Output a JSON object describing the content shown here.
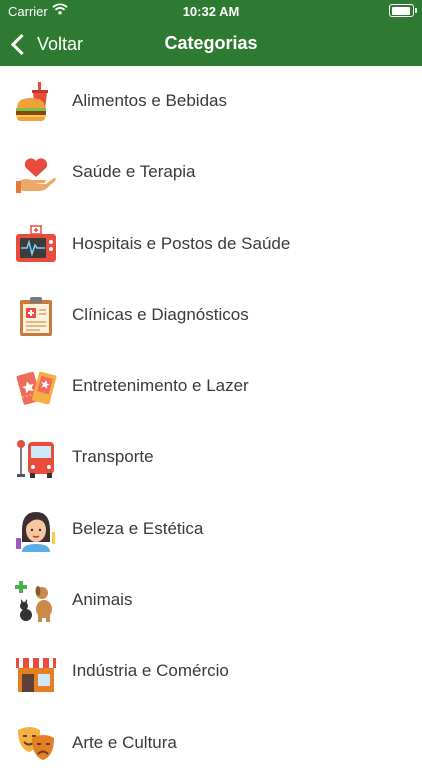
{
  "status_bar": {
    "carrier": "Carrier",
    "time": "10:32 AM"
  },
  "nav": {
    "back_label": "Voltar",
    "title": "Categorias"
  },
  "colors": {
    "header": "#2f7a32",
    "text": "#3a3a3a"
  },
  "categories": [
    {
      "label": "Alimentos e Bebidas",
      "icon": "burger-drink-icon"
    },
    {
      "label": "Saúde e Terapia",
      "icon": "heart-hand-icon"
    },
    {
      "label": "Hospitais e Postos de Saúde",
      "icon": "heart-monitor-icon"
    },
    {
      "label": "Clínicas e Diagnósticos",
      "icon": "clipboard-icon"
    },
    {
      "label": "Entretenimento e Lazer",
      "icon": "tickets-icon"
    },
    {
      "label": "Transporte",
      "icon": "bus-stop-icon"
    },
    {
      "label": "Beleza e Estética",
      "icon": "woman-face-icon"
    },
    {
      "label": "Animais",
      "icon": "pets-icon"
    },
    {
      "label": "Indústria e Comércio",
      "icon": "storefront-icon"
    },
    {
      "label": "Arte e Cultura",
      "icon": "theater-masks-icon"
    }
  ]
}
